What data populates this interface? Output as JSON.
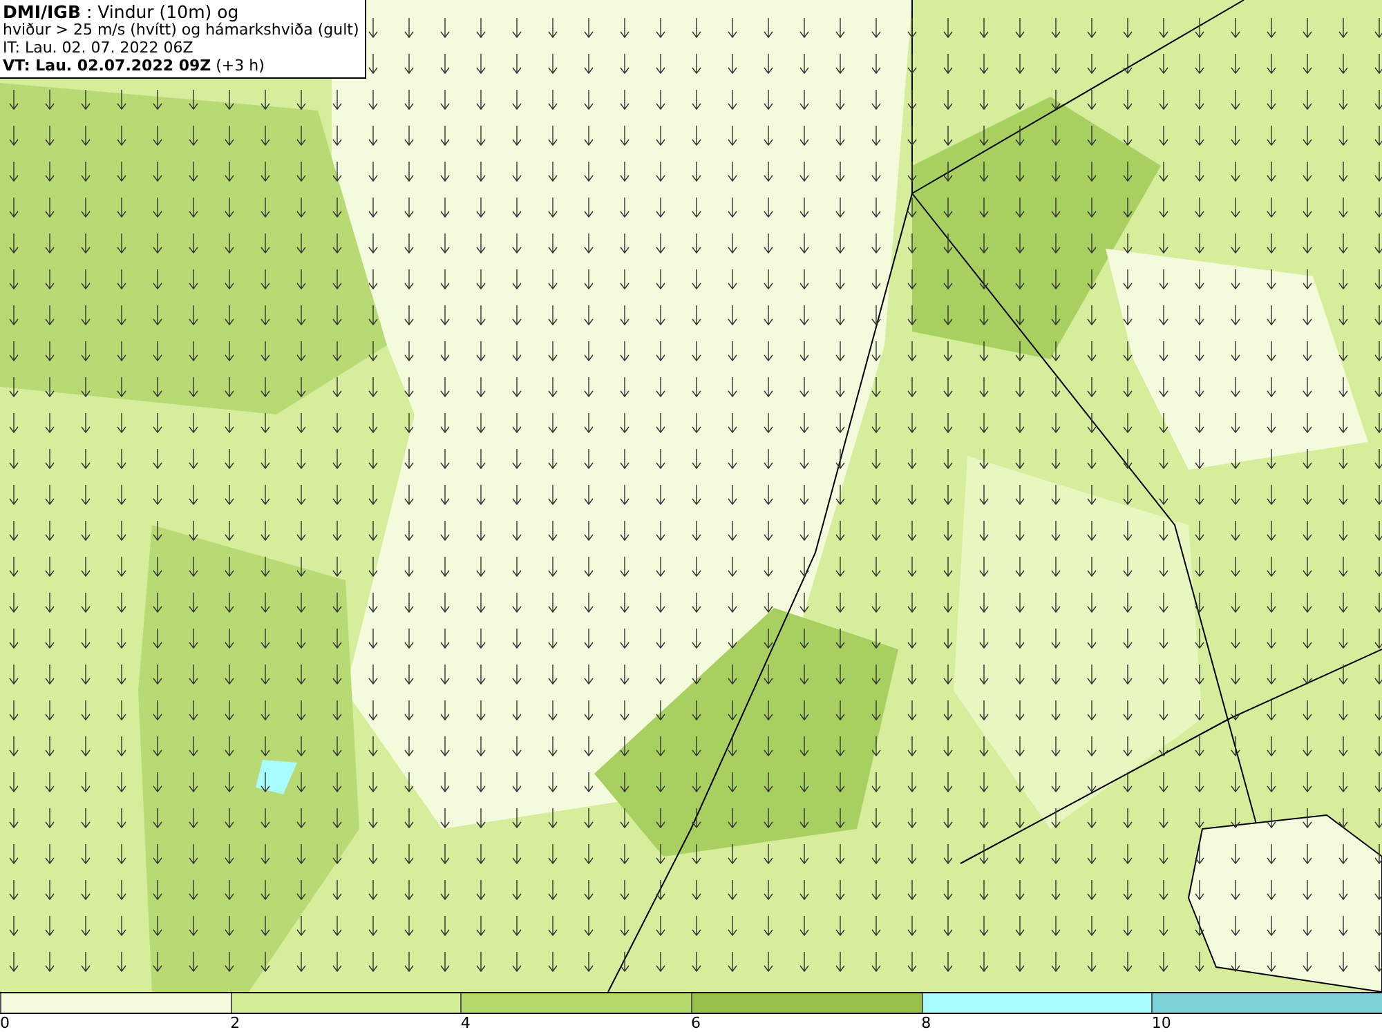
{
  "legend": {
    "lines": [
      "**DMI/IGB** : Vindur (10m) og",
      "hviður > 25 m/s (hvítt) og hámarkshviða (gult)",
      "IT: Lau. 02. 07. 2022 06Z",
      "**VT: Lau. 02.07.2022 09Z** (+3 h)"
    ]
  },
  "colorbar": {
    "segments": [
      {
        "color": "#f4fadc"
      },
      {
        "color": "#d4ee98"
      },
      {
        "color": "#b4d86c"
      },
      {
        "color": "#98c048"
      },
      {
        "color": "#a8fcfc"
      },
      {
        "color": "#7cd4d8"
      }
    ],
    "ticks": [
      "0",
      "2",
      "4",
      "6",
      "8",
      "10"
    ]
  }
}
